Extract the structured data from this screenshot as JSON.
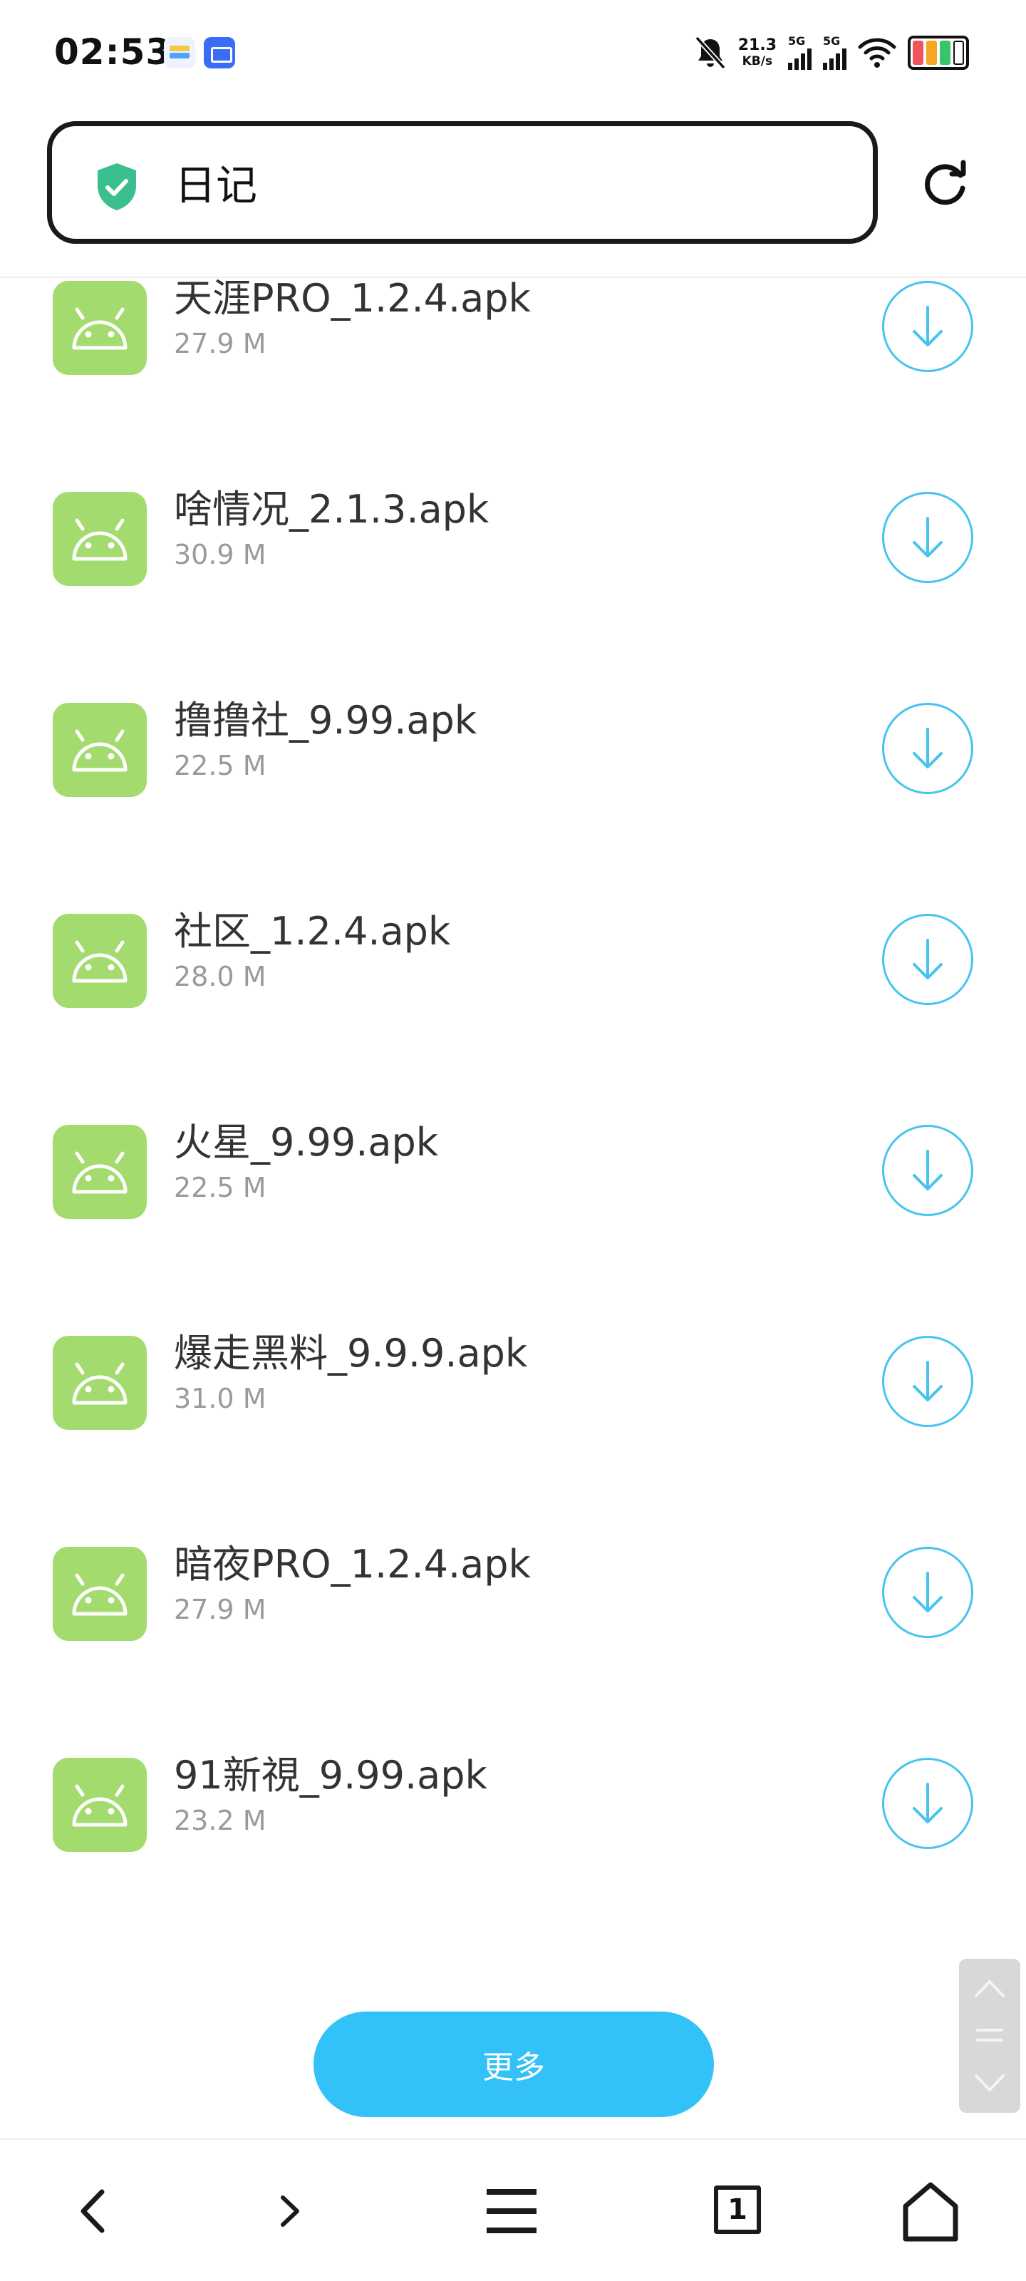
{
  "status_bar": {
    "time": "02:53",
    "net_speed": "21.3",
    "net_unit": "KB/s",
    "sim1": "5G",
    "sim2": "5G"
  },
  "header": {
    "url_text": "日记",
    "shield_color": "#3cbf8f"
  },
  "files": [
    {
      "name": "天涯PRO_1.2.4.apk",
      "size": "27.9 M"
    },
    {
      "name": "啥情况_2.1.3.apk",
      "size": "30.9 M"
    },
    {
      "name": "撸撸社_9.99.apk",
      "size": "22.5 M"
    },
    {
      "name": "社区_1.2.4.apk",
      "size": "28.0 M"
    },
    {
      "name": "火星_9.99.apk",
      "size": "22.5 M"
    },
    {
      "name": "爆走黑料_9.9.9.apk",
      "size": "31.0 M"
    },
    {
      "name": "暗夜PRO_1.2.4.apk",
      "size": "27.9 M"
    },
    {
      "name": "91新視_9.99.apk",
      "size": "23.2 M"
    }
  ],
  "more_label": "更多",
  "bottom_nav": {
    "tab_count": "1"
  },
  "colors": {
    "accent": "#33c2f8",
    "download_ring": "#46c4ee",
    "app_icon_bg": "#a3db6f"
  },
  "icons": {
    "app": "android-icon",
    "download": "download-arrow-icon",
    "refresh": "refresh-icon",
    "security": "shield-check-icon"
  }
}
